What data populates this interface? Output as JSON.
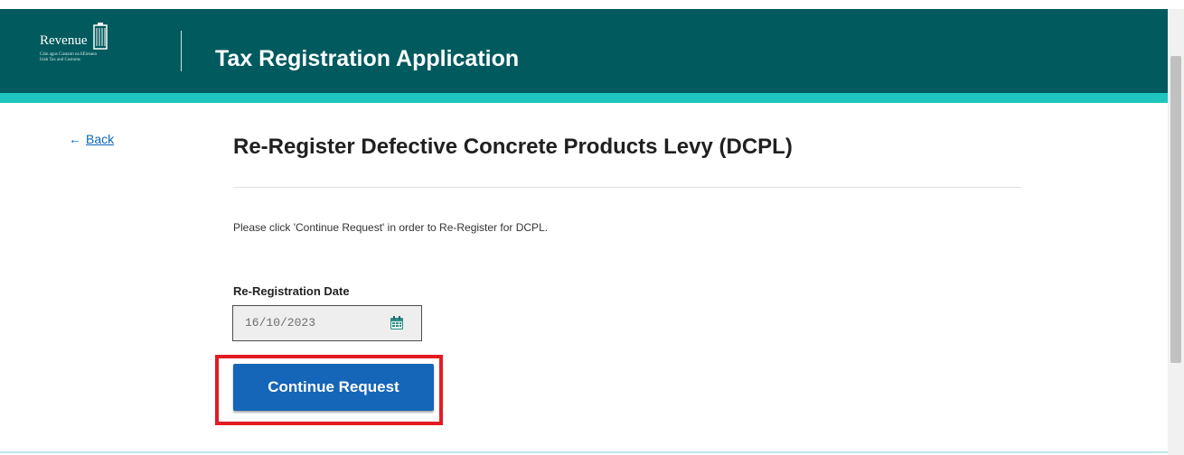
{
  "header": {
    "logo_name": "Revenue",
    "logo_subtitle_1": "Cáin agus Custaim na hÉireann",
    "logo_subtitle_2": "Irish Tax and Customs",
    "app_title": "Tax Registration Application"
  },
  "nav": {
    "back_label": "Back",
    "back_icon": "left-arrow-icon"
  },
  "main": {
    "title": "Re-Register Defective Concrete Products Levy (DCPL)",
    "instruction": "Please click 'Continue Request' in order to Re-Register for DCPL.",
    "date_field": {
      "label": "Re-Registration Date",
      "value": "16/10/2023",
      "icon": "calendar-icon"
    },
    "continue_label": "Continue Request"
  },
  "colors": {
    "header_bg": "#005a5e",
    "header_accent": "#1ec6bf",
    "button_bg": "#1565b8",
    "highlight": "#e31b23",
    "link": "#0b66b8"
  }
}
